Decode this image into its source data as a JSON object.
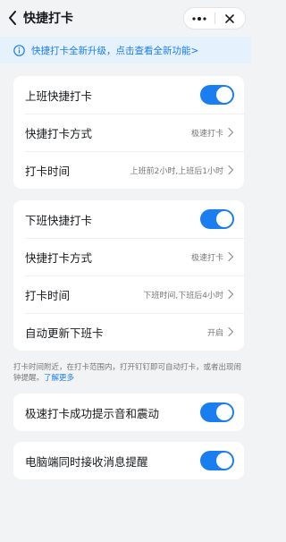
{
  "header": {
    "title": "快捷打卡",
    "more_icon": "ellipsis",
    "close_icon": "close"
  },
  "banner": {
    "text": "快捷打卡全新升级，点击查看全新功能>"
  },
  "clock_in": {
    "rows": [
      {
        "label": "上班快捷打卡",
        "toggle_on": true
      },
      {
        "label": "快捷打卡方式",
        "value": "极速打卡"
      },
      {
        "label": "打卡时间",
        "value": "上班前2小时,上班后1小时"
      }
    ]
  },
  "clock_out": {
    "rows": [
      {
        "label": "下班快捷打卡",
        "toggle_on": true
      },
      {
        "label": "快捷打卡方式",
        "value": "极速打卡"
      },
      {
        "label": "打卡时间",
        "value": "下班时间,下班后4小时"
      },
      {
        "label": "自动更新下班卡",
        "value": "开启"
      }
    ]
  },
  "note": {
    "text": "打卡时间附近，在打卡范围内，打开钉钉即可自动打卡，或者出现闹钟提醒。",
    "link": "了解更多"
  },
  "sound_setting": {
    "label": "极速打卡成功提示音和震动",
    "toggle_on": true
  },
  "desktop_setting": {
    "label": "电脑端同时接收消息提醒",
    "toggle_on": true
  },
  "colors": {
    "accent": "#1a7ef0",
    "background": "#f2f3f5"
  }
}
